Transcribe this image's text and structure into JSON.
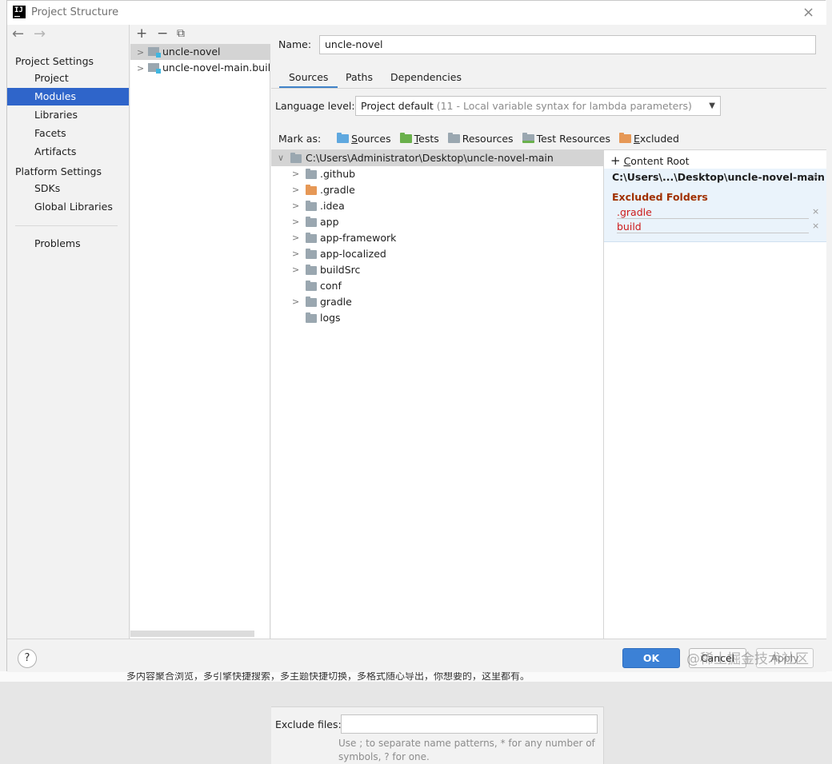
{
  "window": {
    "title": "Project Structure",
    "app_icon": "IJ",
    "close": "×"
  },
  "nav": {
    "back": "←",
    "forward": "→"
  },
  "sidebar": {
    "project_settings_header": "Project Settings",
    "project_items": [
      "Project",
      "Modules",
      "Libraries",
      "Facets",
      "Artifacts"
    ],
    "selected": "Modules",
    "platform_settings_header": "Platform Settings",
    "platform_items": [
      "SDKs",
      "Global Libraries"
    ],
    "problems": "Problems"
  },
  "modules": {
    "toolbar": {
      "add": "+",
      "remove": "−",
      "copy": "⧉"
    },
    "items": [
      "uncle-novel",
      "uncle-novel-main.build"
    ],
    "selected": "uncle-novel"
  },
  "module_settings": {
    "name_label": "Name:",
    "name_value": "uncle-novel",
    "tabs": [
      "Sources",
      "Paths",
      "Dependencies"
    ],
    "active_tab": "Sources",
    "language_level_label": "Language level:",
    "language_level_value": "Project default",
    "language_level_hint": "(11 - Local variable syntax for lambda parameters)",
    "mark_as_label": "Mark as:",
    "mark_as": [
      {
        "label": "Sources",
        "underline": "S",
        "rest": "ources",
        "color": "#5fa8df"
      },
      {
        "label": "Tests",
        "underline": "T",
        "rest": "ests",
        "color": "#6ab04c"
      },
      {
        "label": "Resources",
        "underline": "",
        "rest": "Resources",
        "color": "#9aa7b0"
      },
      {
        "label": "Test Resources",
        "underline": "",
        "rest": "Test Resources",
        "color": "#9aa7b0"
      },
      {
        "label": "Excluded",
        "underline": "E",
        "rest": "xcluded",
        "color": "#e69856"
      }
    ]
  },
  "source_tree": {
    "root": "C:\\Users\\Administrator\\Desktop\\uncle-novel-main",
    "children": [
      {
        "name": ".github",
        "expandable": true,
        "excluded": false
      },
      {
        "name": ".gradle",
        "expandable": true,
        "excluded": true
      },
      {
        "name": ".idea",
        "expandable": true,
        "excluded": false
      },
      {
        "name": "app",
        "expandable": true,
        "excluded": false
      },
      {
        "name": "app-framework",
        "expandable": true,
        "excluded": false
      },
      {
        "name": "app-localized",
        "expandable": true,
        "excluded": false
      },
      {
        "name": "buildSrc",
        "expandable": true,
        "excluded": false
      },
      {
        "name": "conf",
        "expandable": false,
        "excluded": false
      },
      {
        "name": "gradle",
        "expandable": true,
        "excluded": false
      },
      {
        "name": "logs",
        "expandable": false,
        "excluded": false
      }
    ]
  },
  "content_roots": {
    "add_label": "Add Content Root",
    "add_underline": "C",
    "root_path": "C:\\Users\\...\\Desktop\\uncle-novel-main",
    "excluded_title": "Excluded Folders",
    "excluded": [
      ".gradle",
      "build"
    ],
    "remove_icon": "×"
  },
  "exclude_files": {
    "label": "Exclude files:",
    "value": "",
    "hint_line1": "Use ; to separate name patterns, * for any number of",
    "hint_line2": "symbols, ? for one."
  },
  "footer": {
    "help": "?",
    "ok": "OK",
    "cancel": "Cancel",
    "apply": "Apply",
    "watermark": "@稀土掘金技术社区"
  },
  "background": {
    "bottom_text": "多内容聚合浏览，多引擎快捷搜索，多主题快捷切换，多格式随心导出，你想要的，这里都有。"
  }
}
